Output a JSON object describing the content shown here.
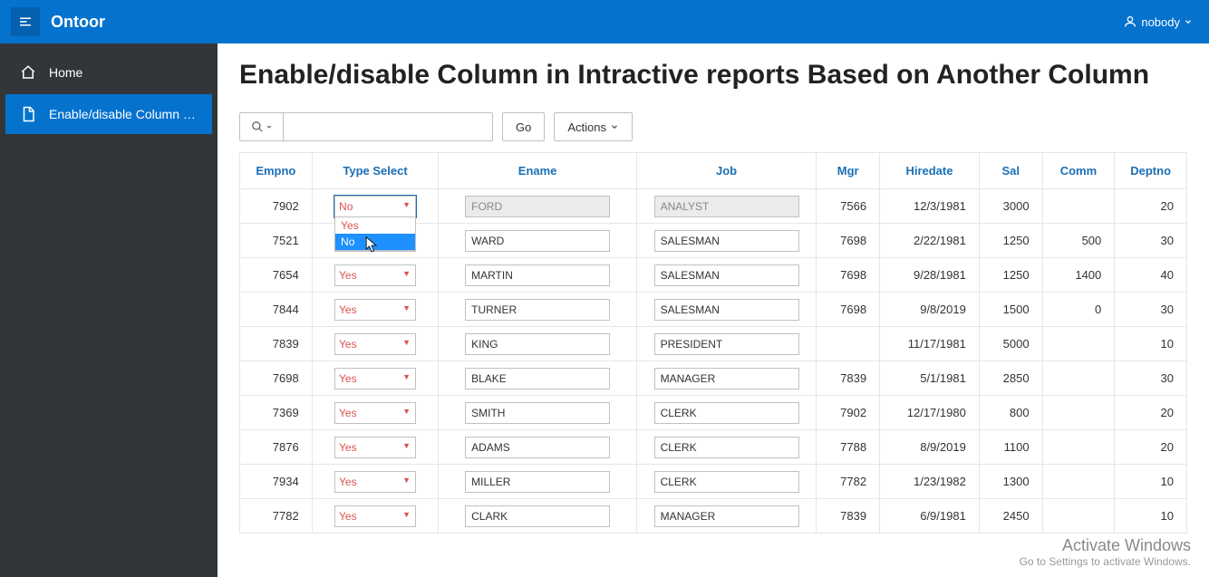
{
  "header": {
    "brand": "Ontoor",
    "user_label": "nobody"
  },
  "sidebar": {
    "items": [
      {
        "label": "Home",
        "icon": "home-icon",
        "active": false
      },
      {
        "label": "Enable/disable Column in …",
        "icon": "file-icon",
        "active": true
      }
    ]
  },
  "page": {
    "title": "Enable/disable Column in Intractive reports Based on Another Column"
  },
  "toolbar": {
    "go_label": "Go",
    "actions_label": "Actions"
  },
  "table": {
    "columns": {
      "empno": "Empno",
      "type_select": "Type Select",
      "ename": "Ename",
      "job": "Job",
      "mgr": "Mgr",
      "hiredate": "Hiredate",
      "sal": "Sal",
      "comm": "Comm",
      "deptno": "Deptno"
    },
    "select_options": [
      "Yes",
      "No"
    ],
    "open_dropdown_row": 0,
    "rows": [
      {
        "empno": "7902",
        "type_select": "No",
        "ename": "FORD",
        "job": "ANALYST",
        "mgr": "7566",
        "hiredate": "12/3/1981",
        "sal": "3000",
        "comm": "",
        "deptno": "20",
        "disabled": true
      },
      {
        "empno": "7521",
        "type_select": "Yes",
        "ename": "WARD",
        "job": "SALESMAN",
        "mgr": "7698",
        "hiredate": "2/22/1981",
        "sal": "1250",
        "comm": "500",
        "deptno": "30",
        "disabled": false
      },
      {
        "empno": "7654",
        "type_select": "Yes",
        "ename": "MARTIN",
        "job": "SALESMAN",
        "mgr": "7698",
        "hiredate": "9/28/1981",
        "sal": "1250",
        "comm": "1400",
        "deptno": "40",
        "disabled": false
      },
      {
        "empno": "7844",
        "type_select": "Yes",
        "ename": "TURNER",
        "job": "SALESMAN",
        "mgr": "7698",
        "hiredate": "9/8/2019",
        "sal": "1500",
        "comm": "0",
        "deptno": "30",
        "disabled": false
      },
      {
        "empno": "7839",
        "type_select": "Yes",
        "ename": "KING",
        "job": "PRESIDENT",
        "mgr": "",
        "hiredate": "11/17/1981",
        "sal": "5000",
        "comm": "",
        "deptno": "10",
        "disabled": false
      },
      {
        "empno": "7698",
        "type_select": "Yes",
        "ename": "BLAKE",
        "job": "MANAGER",
        "mgr": "7839",
        "hiredate": "5/1/1981",
        "sal": "2850",
        "comm": "",
        "deptno": "30",
        "disabled": false
      },
      {
        "empno": "7369",
        "type_select": "Yes",
        "ename": "SMITH",
        "job": "CLERK",
        "mgr": "7902",
        "hiredate": "12/17/1980",
        "sal": "800",
        "comm": "",
        "deptno": "20",
        "disabled": false
      },
      {
        "empno": "7876",
        "type_select": "Yes",
        "ename": "ADAMS",
        "job": "CLERK",
        "mgr": "7788",
        "hiredate": "8/9/2019",
        "sal": "1100",
        "comm": "",
        "deptno": "20",
        "disabled": false
      },
      {
        "empno": "7934",
        "type_select": "Yes",
        "ename": "MILLER",
        "job": "CLERK",
        "mgr": "7782",
        "hiredate": "1/23/1982",
        "sal": "1300",
        "comm": "",
        "deptno": "10",
        "disabled": false
      },
      {
        "empno": "7782",
        "type_select": "Yes",
        "ename": "CLARK",
        "job": "MANAGER",
        "mgr": "7839",
        "hiredate": "6/9/1981",
        "sal": "2450",
        "comm": "",
        "deptno": "10",
        "disabled": false
      }
    ]
  },
  "watermark": {
    "line1": "Activate Windows",
    "line2": "Go to Settings to activate Windows."
  }
}
